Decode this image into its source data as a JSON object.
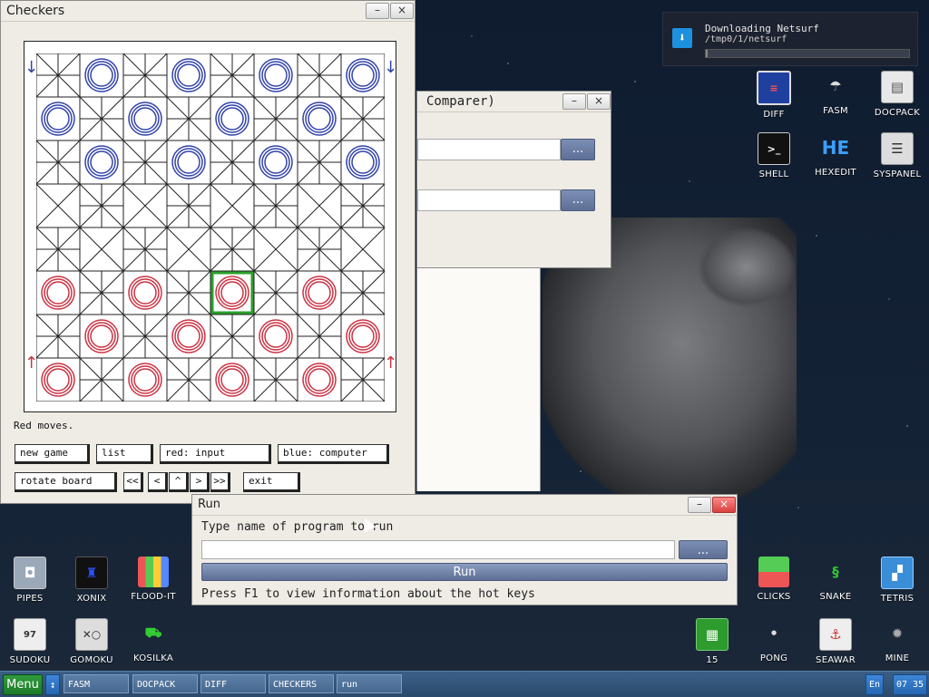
{
  "notification": {
    "title": "Downloading Netsurf",
    "path": "/tmp0/1/netsurf",
    "progress": 0.01
  },
  "checkers": {
    "title": "Checkers",
    "status": "Red moves.",
    "buttons": {
      "new_game": "new game",
      "list": "list",
      "red": "red: input",
      "blue": "blue: computer",
      "rotate": "rotate board",
      "first": "<<",
      "prev": "<",
      "up": "^",
      "next": ">",
      "last": ">>",
      "exit": "exit"
    },
    "board": {
      "light_square_pattern": "crossed",
      "blue_rows": [
        0,
        1,
        2
      ],
      "red_rows": [
        5,
        6,
        7
      ],
      "selected": {
        "row": 5,
        "col": 4
      },
      "empty_dark_squares": [
        [
          3,
          1
        ],
        [
          3,
          3
        ],
        [
          3,
          5
        ],
        [
          3,
          7
        ],
        [
          4,
          0
        ],
        [
          4,
          2
        ],
        [
          4,
          4
        ],
        [
          4,
          6
        ]
      ],
      "pieces": [
        {
          "row": 0,
          "col": 1,
          "color": "blue"
        },
        {
          "row": 0,
          "col": 3,
          "color": "blue"
        },
        {
          "row": 0,
          "col": 5,
          "color": "blue"
        },
        {
          "row": 0,
          "col": 7,
          "color": "blue"
        },
        {
          "row": 1,
          "col": 0,
          "color": "blue"
        },
        {
          "row": 1,
          "col": 2,
          "color": "blue"
        },
        {
          "row": 1,
          "col": 4,
          "color": "blue"
        },
        {
          "row": 1,
          "col": 6,
          "color": "blue"
        },
        {
          "row": 2,
          "col": 1,
          "color": "blue"
        },
        {
          "row": 2,
          "col": 3,
          "color": "blue"
        },
        {
          "row": 2,
          "col": 5,
          "color": "blue"
        },
        {
          "row": 2,
          "col": 7,
          "color": "blue"
        },
        {
          "row": 5,
          "col": 0,
          "color": "red"
        },
        {
          "row": 5,
          "col": 2,
          "color": "red"
        },
        {
          "row": 5,
          "col": 4,
          "color": "red"
        },
        {
          "row": 5,
          "col": 6,
          "color": "red"
        },
        {
          "row": 6,
          "col": 1,
          "color": "red"
        },
        {
          "row": 6,
          "col": 3,
          "color": "red"
        },
        {
          "row": 6,
          "col": 5,
          "color": "red"
        },
        {
          "row": 6,
          "col": 7,
          "color": "red"
        },
        {
          "row": 7,
          "col": 0,
          "color": "red"
        },
        {
          "row": 7,
          "col": 2,
          "color": "red"
        },
        {
          "row": 7,
          "col": 4,
          "color": "red"
        },
        {
          "row": 7,
          "col": 6,
          "color": "red"
        }
      ]
    },
    "colors": {
      "blue": "#3344aa",
      "red": "#cc3344",
      "select": "#2aa02a"
    }
  },
  "comparer": {
    "title": "Comparer)",
    "browse1": "...",
    "browse2": "..."
  },
  "run_dialog": {
    "title": "Run",
    "prompt": "Type name of program to run",
    "input_value": "",
    "browse": "...",
    "run_button": "Run",
    "hint": "Press F1 to view information about the hot keys"
  },
  "desktop_icons": {
    "right_top": [
      {
        "label": "DIFF",
        "icon": "diff-icon"
      },
      {
        "label": "FASM",
        "icon": "fasm-icon"
      },
      {
        "label": "DOCPACK",
        "icon": "docpack-icon"
      },
      {
        "label": "SHELL",
        "icon": "shell-icon"
      },
      {
        "label": "HEXEDIT",
        "icon": "hexedit-icon"
      },
      {
        "label": "SYSPANEL",
        "icon": "syspanel-icon"
      }
    ],
    "bottom_left": [
      {
        "label": "PIPES",
        "icon": "pipes-icon"
      },
      {
        "label": "XONIX",
        "icon": "xonix-icon"
      },
      {
        "label": "FLOOD-IT",
        "icon": "floodit-icon"
      },
      {
        "label": "SUDOKU",
        "icon": "sudoku-icon"
      },
      {
        "label": "GOMOKU",
        "icon": "gomoku-icon"
      },
      {
        "label": "KOSILKA",
        "icon": "kosilka-icon"
      }
    ],
    "bottom_right": [
      {
        "label": "CLICKS",
        "icon": "clicks-icon"
      },
      {
        "label": "SNAKE",
        "icon": "snake-icon"
      },
      {
        "label": "TETRIS",
        "icon": "tetris-icon"
      },
      {
        "label": "15",
        "icon": "fifteen-icon"
      },
      {
        "label": "PONG",
        "icon": "pong-icon"
      },
      {
        "label": "SEAWAR",
        "icon": "seawar-icon"
      },
      {
        "label": "MINE",
        "icon": "mine-icon"
      }
    ]
  },
  "taskbar": {
    "menu": "Menu",
    "swap": "↕",
    "tasks": [
      "FASM",
      "DOCPACK",
      "DIFF",
      "CHECKERS",
      "run"
    ],
    "language": "En",
    "clock": "07 35"
  }
}
